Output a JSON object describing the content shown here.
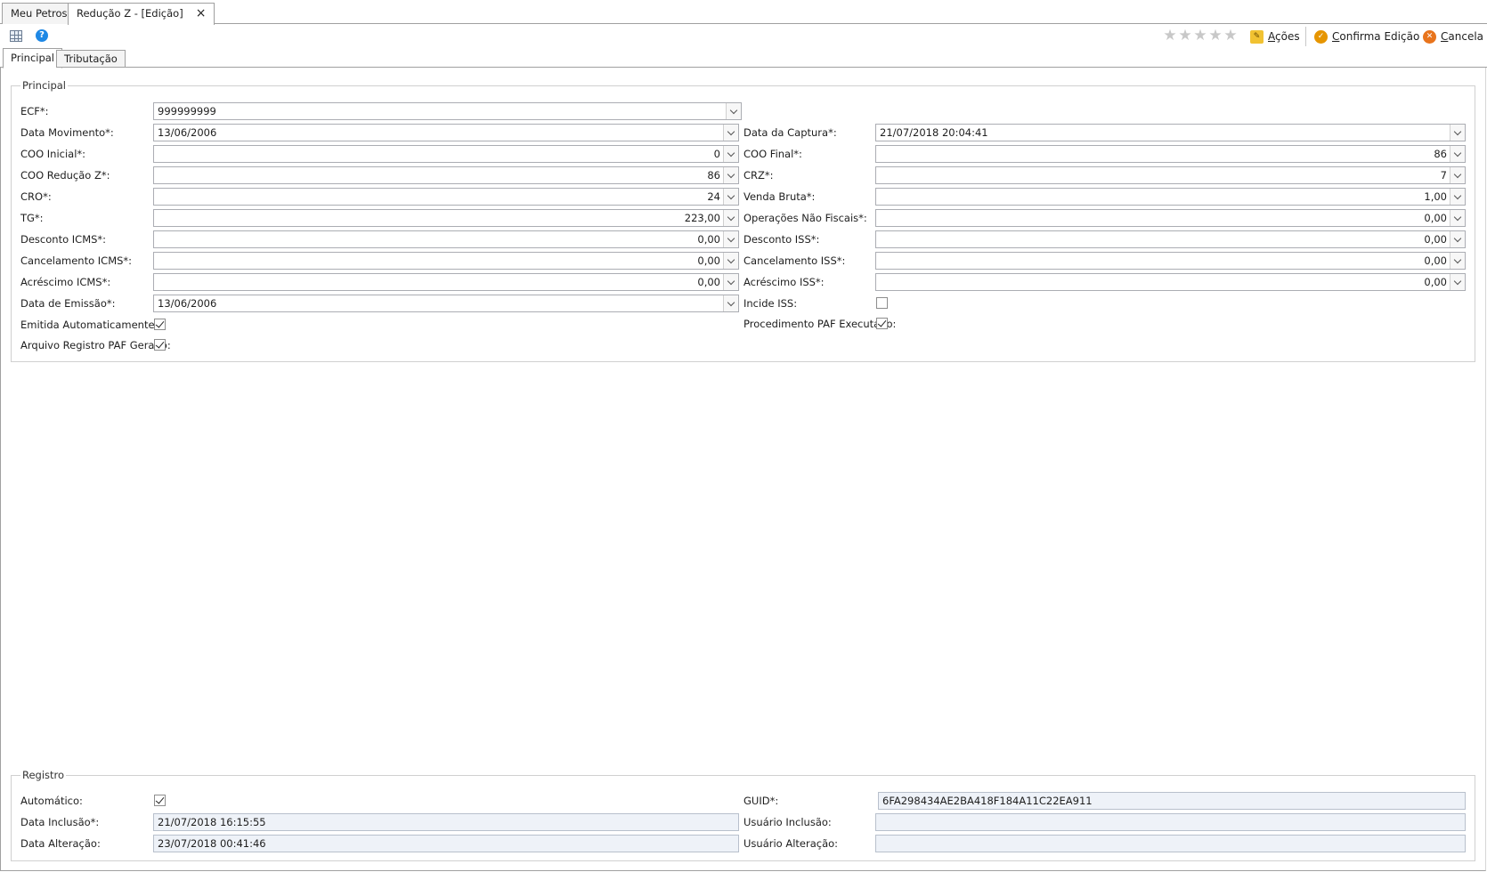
{
  "doc_tabs": {
    "home": "Meu Petros",
    "active": "Redução Z - [Edição]",
    "close": "×"
  },
  "toolbar": {
    "rating": {
      "stars": [
        "★",
        "★",
        "★",
        "★",
        "★"
      ],
      "value": 0,
      "max": 5
    },
    "acoes_first": "A",
    "acoes_rest": "ções",
    "confirma_first": "C",
    "confirma_rest": "onfirma Edição",
    "cancela_first": "C",
    "cancela_rest": "ancela",
    "help_glyph": "?"
  },
  "tabs": {
    "principal": "Principal",
    "tributacao": "Tributação"
  },
  "principal": {
    "legend": "Principal",
    "ecf": {
      "label": "ECF*:",
      "value": "999999999"
    },
    "data_movimento": {
      "label": "Data Movimento*:",
      "value": "13/06/2006"
    },
    "data_captura": {
      "label": "Data da Captura*:",
      "value": "21/07/2018 20:04:41"
    },
    "coo_inicial": {
      "label": "COO Inicial*:",
      "value": "0"
    },
    "coo_final": {
      "label": "COO Final*:",
      "value": "86"
    },
    "coo_reducao": {
      "label": "COO Redução Z*:",
      "value": "86"
    },
    "crz": {
      "label": "CRZ*:",
      "value": "7"
    },
    "cro": {
      "label": "CRO*:",
      "value": "24"
    },
    "venda_bruta": {
      "label": "Venda Bruta*:",
      "value": "1,00"
    },
    "tg": {
      "label": "TG*:",
      "value": "223,00"
    },
    "operacoes_nao_fiscais": {
      "label": "Operações Não Fiscais*:",
      "value": "0,00"
    },
    "desconto_icms": {
      "label": "Desconto ICMS*:",
      "value": "0,00"
    },
    "desconto_iss": {
      "label": "Desconto ISS*:",
      "value": "0,00"
    },
    "cancelamento_icms": {
      "label": "Cancelamento ICMS*:",
      "value": "0,00"
    },
    "cancelamento_iss": {
      "label": "Cancelamento ISS*:",
      "value": "0,00"
    },
    "acrescimo_icms": {
      "label": "Acréscimo ICMS*:",
      "value": "0,00"
    },
    "acrescimo_iss": {
      "label": "Acréscimo ISS*:",
      "value": "0,00"
    },
    "data_emissao": {
      "label": "Data de Emissão*:",
      "value": "13/06/2006"
    },
    "incide_iss": {
      "label": "Incide ISS:",
      "checked": false
    },
    "emitida_auto": {
      "label": "Emitida Automaticamente:",
      "checked": true
    },
    "procedimento_paf": {
      "label": "Procedimento PAF Executado:",
      "checked": true
    },
    "arquivo_paf": {
      "label": "Arquivo Registro PAF Gerado:",
      "checked": true
    }
  },
  "registro": {
    "legend": "Registro",
    "automatico": {
      "label": "Automático:",
      "checked": true
    },
    "guid": {
      "label": "GUID*:",
      "value": "6FA298434AE2BA418F184A11C22EA911"
    },
    "data_inclusao": {
      "label": "Data Inclusão*:",
      "value": "21/07/2018 16:15:55"
    },
    "usuario_inclusao": {
      "label": "Usuário Inclusão:",
      "value": ""
    },
    "data_alteracao": {
      "label": "Data Alteração:",
      "value": "23/07/2018 00:41:46"
    },
    "usuario_alteracao": {
      "label": "Usuário Alteração:",
      "value": ""
    }
  }
}
